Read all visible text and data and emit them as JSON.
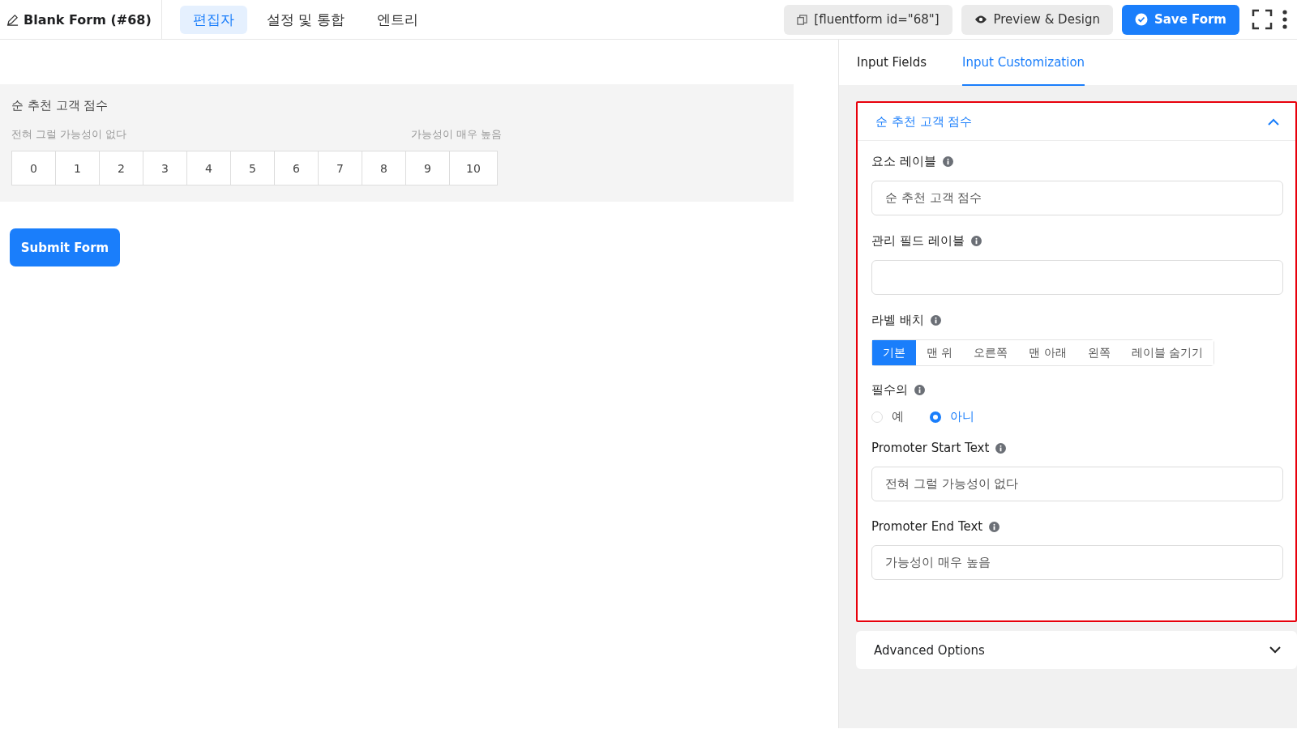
{
  "header": {
    "title": "Blank Form (#68)",
    "tabs": [
      {
        "label": "편집자",
        "selected": true
      },
      {
        "label": "설정 및 통합",
        "selected": false
      },
      {
        "label": "엔트리",
        "selected": false
      }
    ],
    "shortcode": "[fluentform id=\"68\"]",
    "preview_button": "Preview & Design",
    "save_button": "Save Form"
  },
  "form_preview": {
    "field_label": "순 추천 고객 점수",
    "start_text": "전혀 그럴 가능성이 없다",
    "end_text": "가능성이 매우 높음",
    "scale": [
      "0",
      "1",
      "2",
      "3",
      "4",
      "5",
      "6",
      "7",
      "8",
      "9",
      "10"
    ],
    "submit_button": "Submit Form"
  },
  "panel": {
    "tabs": [
      {
        "label": "Input Fields",
        "selected": false
      },
      {
        "label": "Input Customization",
        "selected": true
      }
    ],
    "section": {
      "title": "순 추천 고객 점수",
      "expanded": true,
      "fields": [
        {
          "kind": "text",
          "label": "요소 레이블",
          "value": "순 추천 고객 점수"
        },
        {
          "kind": "text",
          "label": "관리 필드 레이블"
        },
        {
          "kind": "segmented",
          "label": "라벨 배치",
          "options": [
            {
              "label": "기본",
              "selected": true
            },
            {
              "label": "맨 위",
              "selected": false
            },
            {
              "label": "오른쪽",
              "selected": false
            },
            {
              "label": "맨 아래",
              "selected": false
            },
            {
              "label": "왼쪽",
              "selected": false
            },
            {
              "label": "레이블 숨기기",
              "selected": false
            }
          ]
        },
        {
          "kind": "radio",
          "label": "필수의",
          "options": [
            {
              "label": "예",
              "selected": false
            },
            {
              "label": "아니",
              "selected": true
            }
          ]
        },
        {
          "kind": "text",
          "label": "Promoter Start Text",
          "value": "전혀 그럴 가능성이 없다"
        },
        {
          "kind": "text",
          "label": "Promoter End Text",
          "value": "가능성이 매우 높음"
        }
      ]
    },
    "advanced": {
      "title": "Advanced Options",
      "expanded": false
    }
  }
}
